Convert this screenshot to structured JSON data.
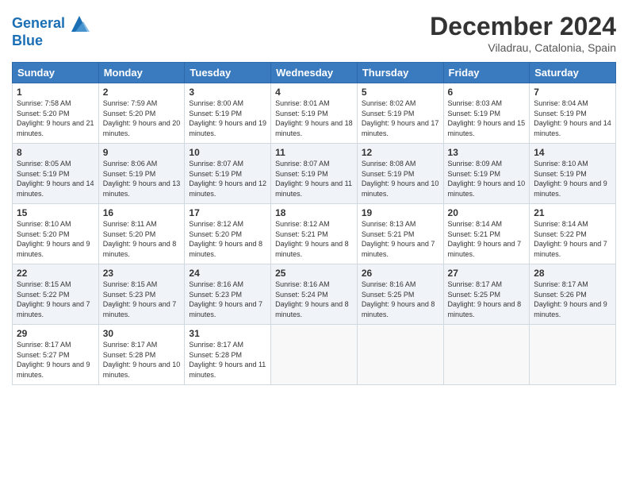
{
  "logo": {
    "line1": "General",
    "line2": "Blue"
  },
  "title": "December 2024",
  "subtitle": "Viladrau, Catalonia, Spain",
  "headers": [
    "Sunday",
    "Monday",
    "Tuesday",
    "Wednesday",
    "Thursday",
    "Friday",
    "Saturday"
  ],
  "weeks": [
    [
      {
        "day": "1",
        "sunrise": "7:58 AM",
        "sunset": "5:20 PM",
        "daylight": "9 hours and 21 minutes."
      },
      {
        "day": "2",
        "sunrise": "7:59 AM",
        "sunset": "5:20 PM",
        "daylight": "9 hours and 20 minutes."
      },
      {
        "day": "3",
        "sunrise": "8:00 AM",
        "sunset": "5:19 PM",
        "daylight": "9 hours and 19 minutes."
      },
      {
        "day": "4",
        "sunrise": "8:01 AM",
        "sunset": "5:19 PM",
        "daylight": "9 hours and 18 minutes."
      },
      {
        "day": "5",
        "sunrise": "8:02 AM",
        "sunset": "5:19 PM",
        "daylight": "9 hours and 17 minutes."
      },
      {
        "day": "6",
        "sunrise": "8:03 AM",
        "sunset": "5:19 PM",
        "daylight": "9 hours and 15 minutes."
      },
      {
        "day": "7",
        "sunrise": "8:04 AM",
        "sunset": "5:19 PM",
        "daylight": "9 hours and 14 minutes."
      }
    ],
    [
      {
        "day": "8",
        "sunrise": "8:05 AM",
        "sunset": "5:19 PM",
        "daylight": "9 hours and 14 minutes."
      },
      {
        "day": "9",
        "sunrise": "8:06 AM",
        "sunset": "5:19 PM",
        "daylight": "9 hours and 13 minutes."
      },
      {
        "day": "10",
        "sunrise": "8:07 AM",
        "sunset": "5:19 PM",
        "daylight": "9 hours and 12 minutes."
      },
      {
        "day": "11",
        "sunrise": "8:07 AM",
        "sunset": "5:19 PM",
        "daylight": "9 hours and 11 minutes."
      },
      {
        "day": "12",
        "sunrise": "8:08 AM",
        "sunset": "5:19 PM",
        "daylight": "9 hours and 10 minutes."
      },
      {
        "day": "13",
        "sunrise": "8:09 AM",
        "sunset": "5:19 PM",
        "daylight": "9 hours and 10 minutes."
      },
      {
        "day": "14",
        "sunrise": "8:10 AM",
        "sunset": "5:19 PM",
        "daylight": "9 hours and 9 minutes."
      }
    ],
    [
      {
        "day": "15",
        "sunrise": "8:10 AM",
        "sunset": "5:20 PM",
        "daylight": "9 hours and 9 minutes."
      },
      {
        "day": "16",
        "sunrise": "8:11 AM",
        "sunset": "5:20 PM",
        "daylight": "9 hours and 8 minutes."
      },
      {
        "day": "17",
        "sunrise": "8:12 AM",
        "sunset": "5:20 PM",
        "daylight": "9 hours and 8 minutes."
      },
      {
        "day": "18",
        "sunrise": "8:12 AM",
        "sunset": "5:21 PM",
        "daylight": "9 hours and 8 minutes."
      },
      {
        "day": "19",
        "sunrise": "8:13 AM",
        "sunset": "5:21 PM",
        "daylight": "9 hours and 7 minutes."
      },
      {
        "day": "20",
        "sunrise": "8:14 AM",
        "sunset": "5:21 PM",
        "daylight": "9 hours and 7 minutes."
      },
      {
        "day": "21",
        "sunrise": "8:14 AM",
        "sunset": "5:22 PM",
        "daylight": "9 hours and 7 minutes."
      }
    ],
    [
      {
        "day": "22",
        "sunrise": "8:15 AM",
        "sunset": "5:22 PM",
        "daylight": "9 hours and 7 minutes."
      },
      {
        "day": "23",
        "sunrise": "8:15 AM",
        "sunset": "5:23 PM",
        "daylight": "9 hours and 7 minutes."
      },
      {
        "day": "24",
        "sunrise": "8:16 AM",
        "sunset": "5:23 PM",
        "daylight": "9 hours and 7 minutes."
      },
      {
        "day": "25",
        "sunrise": "8:16 AM",
        "sunset": "5:24 PM",
        "daylight": "9 hours and 8 minutes."
      },
      {
        "day": "26",
        "sunrise": "8:16 AM",
        "sunset": "5:25 PM",
        "daylight": "9 hours and 8 minutes."
      },
      {
        "day": "27",
        "sunrise": "8:17 AM",
        "sunset": "5:25 PM",
        "daylight": "9 hours and 8 minutes."
      },
      {
        "day": "28",
        "sunrise": "8:17 AM",
        "sunset": "5:26 PM",
        "daylight": "9 hours and 9 minutes."
      }
    ],
    [
      {
        "day": "29",
        "sunrise": "8:17 AM",
        "sunset": "5:27 PM",
        "daylight": "9 hours and 9 minutes."
      },
      {
        "day": "30",
        "sunrise": "8:17 AM",
        "sunset": "5:28 PM",
        "daylight": "9 hours and 10 minutes."
      },
      {
        "day": "31",
        "sunrise": "8:17 AM",
        "sunset": "5:28 PM",
        "daylight": "9 hours and 11 minutes."
      },
      null,
      null,
      null,
      null
    ]
  ]
}
